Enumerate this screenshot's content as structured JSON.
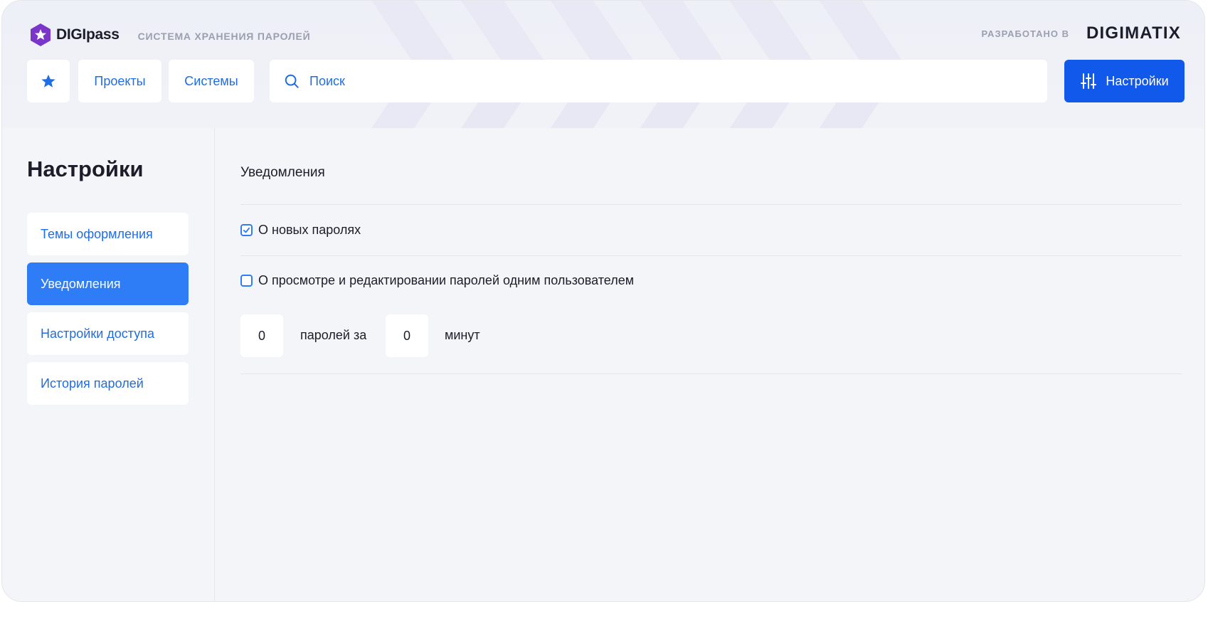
{
  "brand": {
    "logo_text": "DIGIpass",
    "tagline": "СИСТЕМА ХРАНЕНИЯ ПАРОЛЕЙ"
  },
  "developer": {
    "label": "РАЗРАБОТАНО В",
    "name": "DIGIMATIX"
  },
  "nav": {
    "favorites_icon": "star-icon",
    "projects_label": "Проекты",
    "systems_label": "Системы",
    "search_placeholder": "Поиск",
    "settings_label": "Настройки"
  },
  "sidebar": {
    "title": "Настройки",
    "items": [
      {
        "label": "Темы оформления",
        "active": false
      },
      {
        "label": "Уведомления",
        "active": true
      },
      {
        "label": "Настройки доступа",
        "active": false
      },
      {
        "label": "История паролей",
        "active": false
      }
    ]
  },
  "notifications": {
    "title": "Уведомления",
    "options": [
      {
        "label": "О новых паролях",
        "checked": true
      },
      {
        "label": "О просмотре и редактировании паролей одним пользователем",
        "checked": false
      }
    ],
    "threshold": {
      "passwords_value": "0",
      "passwords_label": "паролей за",
      "minutes_value": "0",
      "minutes_label": "минут"
    }
  },
  "colors": {
    "accent": "#1059ea",
    "active_item": "#2e7cf6",
    "link": "#1e6de6",
    "logo": "#7a35c9"
  }
}
